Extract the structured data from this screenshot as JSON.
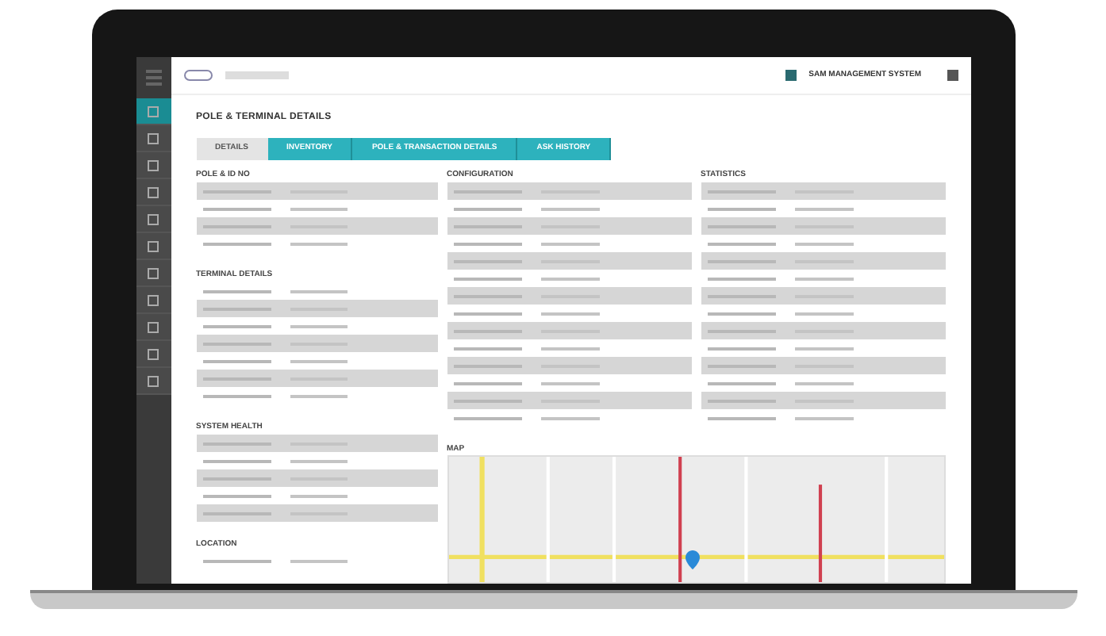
{
  "header": {
    "title": "SAM MANAGEMENT SYSTEM"
  },
  "sidebar": [
    {
      "selected": true
    },
    {
      "selected": false
    },
    {
      "selected": false
    },
    {
      "selected": false
    },
    {
      "selected": false
    },
    {
      "selected": false
    },
    {
      "selected": false
    },
    {
      "selected": false
    },
    {
      "selected": false
    },
    {
      "selected": false
    },
    {
      "selected": false
    }
  ],
  "page_title": "POLE & TERMINAL DETAILS",
  "tabs": [
    {
      "label": "DETAILS",
      "selected": true
    },
    {
      "label": "INVENTORY",
      "selected": false
    },
    {
      "label": "POLE & TRANSACTION DETAILS",
      "selected": false
    },
    {
      "label": "ASK HISTORY",
      "selected": false
    }
  ],
  "left_sections": [
    {
      "title": "POLE & ID NO",
      "rows": [
        {
          "shaded": true
        },
        {
          "shaded": false
        },
        {
          "shaded": true
        },
        {
          "shaded": false
        }
      ]
    },
    {
      "title": "TERMINAL DETAILS",
      "rows": [
        {
          "shaded": false
        },
        {
          "shaded": true
        },
        {
          "shaded": false
        },
        {
          "shaded": true
        },
        {
          "shaded": false
        },
        {
          "shaded": true
        },
        {
          "shaded": false
        }
      ]
    },
    {
      "title": "SYSTEM HEALTH",
      "rows": [
        {
          "shaded": true
        },
        {
          "shaded": false
        },
        {
          "shaded": true
        },
        {
          "shaded": false
        },
        {
          "shaded": true
        }
      ]
    },
    {
      "title": "LOCATION",
      "rows": [
        {
          "shaded": false
        }
      ]
    }
  ],
  "top_sections": [
    {
      "title": "CONFIGURATION",
      "rows": [
        {
          "shaded": true
        },
        {
          "shaded": false
        },
        {
          "shaded": true
        },
        {
          "shaded": false
        },
        {
          "shaded": true
        },
        {
          "shaded": false
        },
        {
          "shaded": true
        },
        {
          "shaded": false
        },
        {
          "shaded": true
        },
        {
          "shaded": false
        },
        {
          "shaded": true
        },
        {
          "shaded": false
        },
        {
          "shaded": true
        },
        {
          "shaded": false
        }
      ]
    },
    {
      "title": "STATISTICS",
      "rows": [
        {
          "shaded": true
        },
        {
          "shaded": false
        },
        {
          "shaded": true
        },
        {
          "shaded": false
        },
        {
          "shaded": true
        },
        {
          "shaded": false
        },
        {
          "shaded": true
        },
        {
          "shaded": false
        },
        {
          "shaded": true
        },
        {
          "shaded": false
        },
        {
          "shaded": true
        },
        {
          "shaded": false
        },
        {
          "shaded": true
        },
        {
          "shaded": false
        }
      ]
    }
  ],
  "map": {
    "title": "MAP"
  }
}
